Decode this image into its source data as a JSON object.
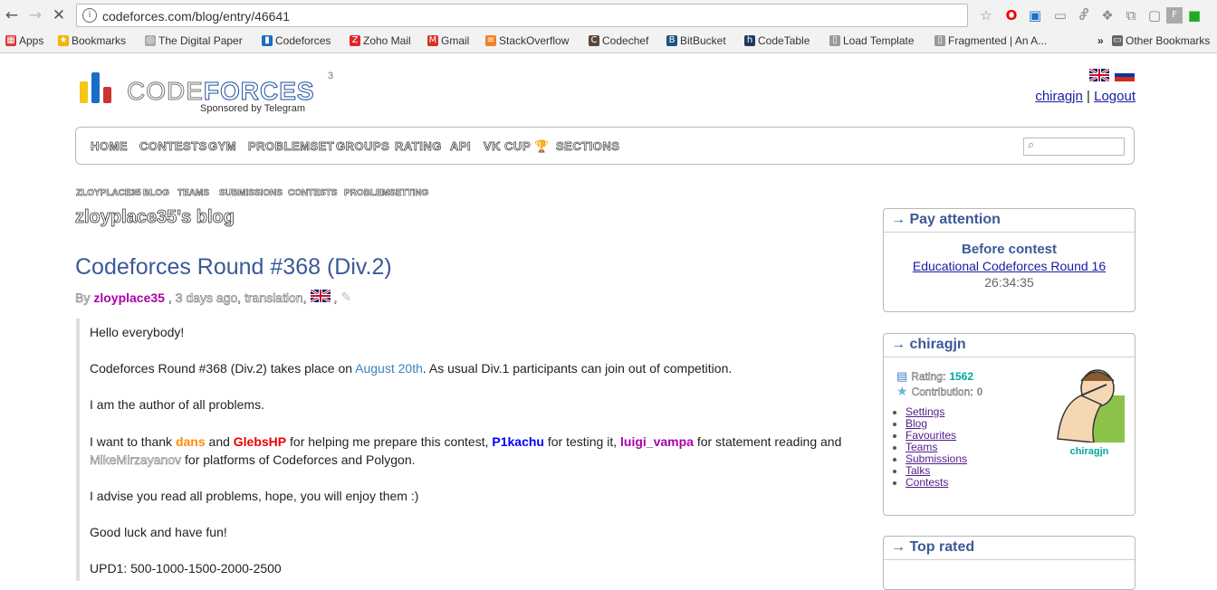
{
  "browser": {
    "url": "codeforces.com/blog/entry/46641",
    "bookmarks": [
      {
        "label": "Apps",
        "icon": "apps-grid-icon",
        "color": "#d33"
      },
      {
        "label": "Bookmarks",
        "icon": "star-icon",
        "color": "#f5b400"
      },
      {
        "label": "The Digital Paper",
        "icon": "globe-icon",
        "color": "#aaa"
      },
      {
        "label": "Codeforces",
        "icon": "codeforces-icon",
        "color": "#1a6ec5"
      },
      {
        "label": "Zoho Mail",
        "icon": "zoho-icon",
        "color": "#e42527"
      },
      {
        "label": "Gmail",
        "icon": "gmail-icon",
        "color": "#d93025"
      },
      {
        "label": "StackOverflow",
        "icon": "stackoverflow-icon",
        "color": "#f48024"
      },
      {
        "label": "Codechef",
        "icon": "codechef-icon",
        "color": "#5b4638"
      },
      {
        "label": "BitBucket",
        "icon": "bitbucket-icon",
        "color": "#205081"
      },
      {
        "label": "CodeTable",
        "icon": "codetable-icon",
        "color": "#1e3a5f"
      },
      {
        "label": "Load Template",
        "icon": "page-icon",
        "color": "#999"
      },
      {
        "label": "Fragmented | An A...",
        "icon": "page-icon",
        "color": "#999"
      },
      {
        "label": "Other Bookmarks",
        "icon": "folder-icon",
        "color": "#666"
      }
    ],
    "more": "»"
  },
  "header": {
    "logo_part1": "CODE",
    "logo_part2": "FORCES",
    "logo_sup": "3",
    "sponsor": "Sponsored by Telegram",
    "user": "chiragjn",
    "separator": "|",
    "logout": "Logout"
  },
  "menu": [
    "HOME",
    "CONTESTS",
    "GYM",
    "PROBLEMSET",
    "GROUPS",
    "RATING",
    "API",
    "VK CUP",
    "SECTIONS"
  ],
  "submenu": [
    "ZLOYPLACE35",
    "BLOG",
    "TEAMS",
    "SUBMISSIONS",
    "CONTESTS",
    "PROBLEMSETTING"
  ],
  "blog": {
    "owner_title": "zloyplace35's blog",
    "post_title": "Codeforces Round #368 (Div.2)",
    "by": "By",
    "author": "zloyplace35",
    "meta": ", 3 days ago, translation,",
    "comma": ","
  },
  "post": {
    "p1": "Hello everybody!",
    "p2a": "Codeforces Round #368 (Div.2) takes place on ",
    "p2link": "August 20th",
    "p2b": ". As usual Div.1 participants can join out of competition.",
    "p3": "I am the author of all problems.",
    "p4a": "I want to thank ",
    "h_dans": "dans",
    "p4b": " and ",
    "h_glebs": "GlebsHP",
    "p4c": " for helping me prepare this contest, ",
    "h_p1": "P1kachu",
    "p4d": " for testing it, ",
    "h_luigi": "luigi_vampa",
    "p4e": " for statement reading and",
    "h_mike": "MikeMirzayanov",
    "p4f": " for platforms of Codeforces and Polygon.",
    "p5": "I advise you read all problems, hope, you will enjoy them :)",
    "p6": "Good luck and have fun!",
    "p7": "UPD1: 500-1000-1500-2000-2500"
  },
  "sidebar": {
    "pay_caption": "→ Pay attention",
    "before": "Before contest",
    "contest_link": "Educational Codeforces Round 16",
    "countdown": "26:34:35",
    "user_caption": "→ chiragjn",
    "rating_label": "Rating:",
    "rating_value": "1562",
    "contrib_label": "Contribution:",
    "contrib_value": "0",
    "avatar_name": "chiragjn",
    "links": [
      "Settings",
      "Blog",
      "Favourites",
      "Teams",
      "Submissions",
      "Talks",
      "Contests"
    ],
    "top_caption": "→ Top rated"
  },
  "colors": {
    "title_blue": "#3b5998",
    "author_violet": "#aa00aa",
    "rating_teal": "#03a89e"
  }
}
